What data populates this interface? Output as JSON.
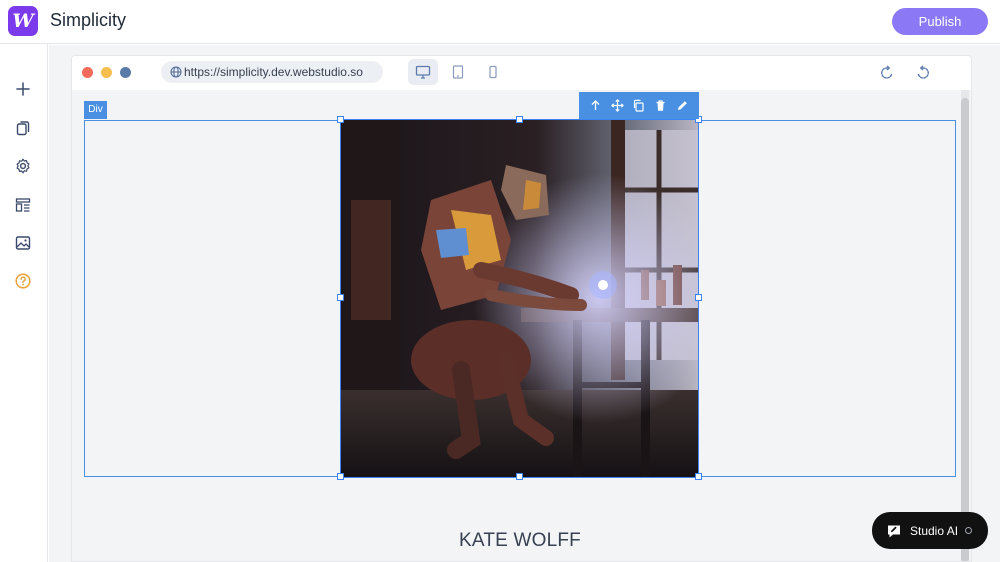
{
  "app": {
    "name": "Simplicity",
    "logo_letter": "W",
    "brand_color": "#7c3aed"
  },
  "toolbar": {
    "publish_label": "Publish",
    "publish_color": "#8b78f5"
  },
  "sidebar": {
    "items": [
      {
        "icon": "plus-icon"
      },
      {
        "icon": "pages-icon"
      },
      {
        "icon": "settings-icon"
      },
      {
        "icon": "layout-icon"
      },
      {
        "icon": "image-icon"
      },
      {
        "icon": "help-icon"
      }
    ]
  },
  "browser": {
    "url": "https://simplicity.dev.webstudio.so",
    "devices": [
      "desktop-icon",
      "tablet-icon",
      "mobile-icon"
    ],
    "traffic_colors": [
      "#f26b5b",
      "#f5be4f",
      "#5a7aa8"
    ]
  },
  "canvas": {
    "selected_label": "Div",
    "selection_color": "#4a90e2",
    "image_actions": [
      "arrow-up-icon",
      "move-icon",
      "duplicate-icon",
      "trash-icon",
      "edit-icon"
    ],
    "heading": "KATE WOLFF"
  },
  "assistant": {
    "label": "Studio AI"
  }
}
